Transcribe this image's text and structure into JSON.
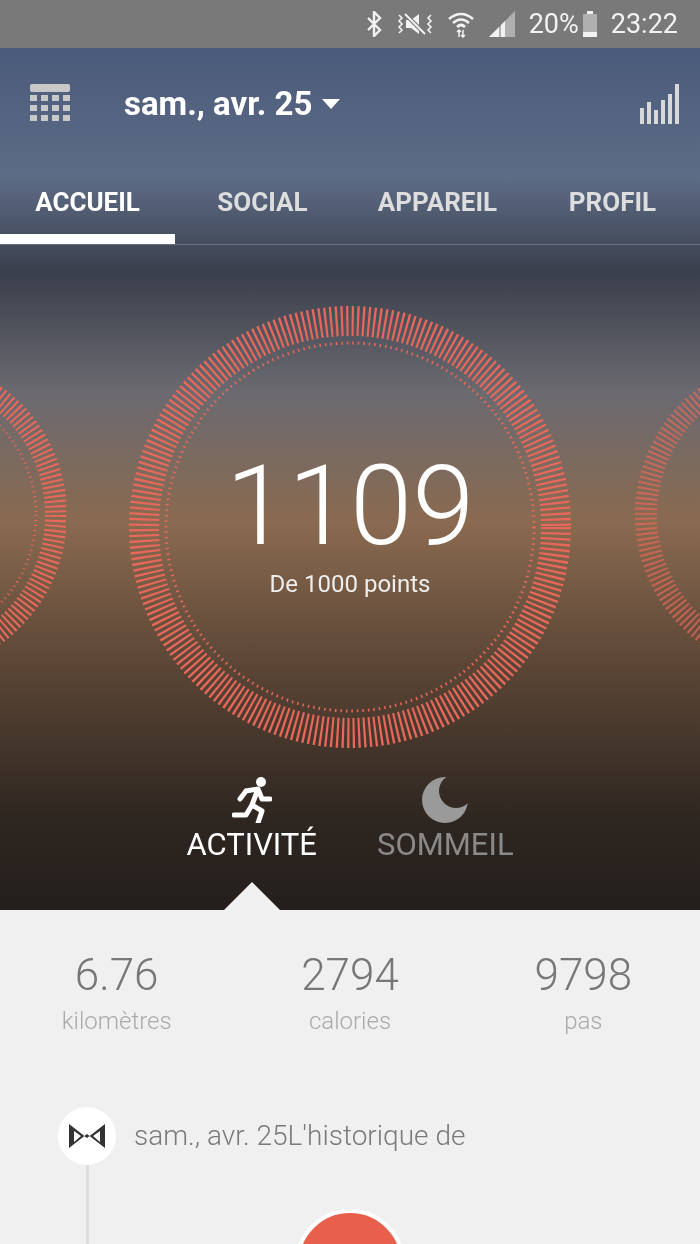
{
  "status_bar": {
    "battery": "20%",
    "time": "23:22"
  },
  "header": {
    "date": "sam., avr. 25"
  },
  "tabs": [
    {
      "label": "ACCUEIL",
      "selected": true
    },
    {
      "label": "SOCIAL",
      "selected": false
    },
    {
      "label": "APPAREIL",
      "selected": false
    },
    {
      "label": "PROFIL",
      "selected": false
    }
  ],
  "score": {
    "value": "1109",
    "caption": "De 1000 points"
  },
  "modes": [
    {
      "kind": "activity",
      "label": "ACTIVITÉ",
      "selected": true
    },
    {
      "kind": "sleep",
      "label": "SOMMEIL",
      "selected": false
    }
  ],
  "stats": [
    {
      "value": "6.76",
      "unit": "kilomètres"
    },
    {
      "value": "2794",
      "unit": "calories"
    },
    {
      "value": "9798",
      "unit": "pas"
    }
  ],
  "timeline": {
    "entry": "sam., avr. 25L'historique de"
  }
}
